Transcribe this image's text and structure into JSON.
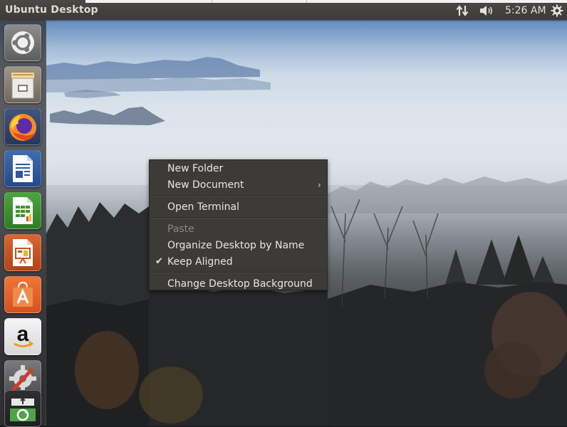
{
  "panel": {
    "title": "Ubuntu Desktop",
    "clock": "5:26 AM",
    "icons": [
      "network-icon",
      "sound-icon",
      "gear-icon"
    ]
  },
  "launcher": {
    "items": [
      {
        "name": "ubuntu-dash",
        "icon": "ubuntu-logo-icon",
        "color": "#7a7a7a"
      },
      {
        "name": "files",
        "icon": "filing-cabinet-icon",
        "color": "#9b8e7c"
      },
      {
        "name": "firefox",
        "icon": "firefox-icon",
        "color": "#e55b13"
      },
      {
        "name": "libreoffice-writer",
        "icon": "writer-document-icon",
        "color": "#2d64a8"
      },
      {
        "name": "libreoffice-calc",
        "icon": "calc-spreadsheet-icon",
        "color": "#3e9b32"
      },
      {
        "name": "libreoffice-impress",
        "icon": "impress-presentation-icon",
        "color": "#d2582b"
      },
      {
        "name": "ubuntu-software",
        "icon": "software-bag-icon",
        "color": "#e8622a"
      },
      {
        "name": "amazon",
        "icon": "amazon-icon",
        "color": "#f0f0f0"
      },
      {
        "name": "system-settings",
        "icon": "settings-wrench-icon",
        "color": "#6d6d6d"
      },
      {
        "name": "software-updater",
        "icon": "updater-icon",
        "color": "#3c7a3c"
      }
    ]
  },
  "context_menu": {
    "items": [
      {
        "label": "New Folder",
        "enabled": true
      },
      {
        "label": "New Document",
        "enabled": true,
        "submenu": true
      },
      {
        "label": "Open Terminal",
        "enabled": true
      },
      {
        "label": "Paste",
        "enabled": false
      },
      {
        "label": "Organize Desktop by Name",
        "enabled": true
      },
      {
        "label": "Keep Aligned",
        "enabled": true,
        "checked": true
      },
      {
        "label": "Change Desktop Background",
        "enabled": true
      }
    ],
    "submenu_glyph": "›",
    "check_glyph": "✔"
  }
}
